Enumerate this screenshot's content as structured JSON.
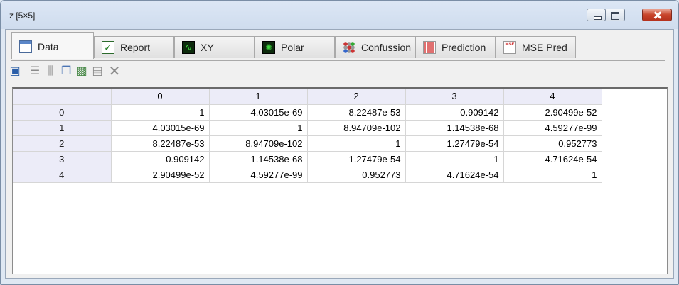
{
  "window": {
    "title": "z [5×5]"
  },
  "tabs": [
    {
      "label": "Data",
      "icon": "table-icon"
    },
    {
      "label": "Report",
      "icon": "checkmark-icon"
    },
    {
      "label": "XY",
      "icon": "xy-plot-icon"
    },
    {
      "label": "Polar",
      "icon": "polar-plot-icon"
    },
    {
      "label": "Confussion",
      "icon": "dots-matrix-icon"
    },
    {
      "label": "Prediction",
      "icon": "grid-icon"
    },
    {
      "label": "MSE Pred",
      "icon": "mse-icon"
    }
  ],
  "toolbar": [
    {
      "icon": "save-icon"
    },
    {
      "icon": "insert-row-icon"
    },
    {
      "icon": "insert-column-icon"
    },
    {
      "icon": "copy-icon"
    },
    {
      "icon": "copy-image-icon"
    },
    {
      "icon": "paste-icon"
    },
    {
      "icon": "delete-icon"
    }
  ],
  "table": {
    "columns": [
      "0",
      "1",
      "2",
      "3",
      "4"
    ],
    "rows": [
      {
        "label": "0",
        "cells": [
          "1",
          "4.03015e-69",
          "8.22487e-53",
          "0.909142",
          "2.90499e-52"
        ]
      },
      {
        "label": "1",
        "cells": [
          "4.03015e-69",
          "1",
          "8.94709e-102",
          "1.14538e-68",
          "4.59277e-99"
        ]
      },
      {
        "label": "2",
        "cells": [
          "8.22487e-53",
          "8.94709e-102",
          "1",
          "1.27479e-54",
          "0.952773"
        ]
      },
      {
        "label": "3",
        "cells": [
          "0.909142",
          "1.14538e-68",
          "1.27479e-54",
          "1",
          "4.71624e-54"
        ]
      },
      {
        "label": "4",
        "cells": [
          "2.90499e-52",
          "4.59277e-99",
          "0.952773",
          "4.71624e-54",
          "1"
        ]
      }
    ]
  }
}
